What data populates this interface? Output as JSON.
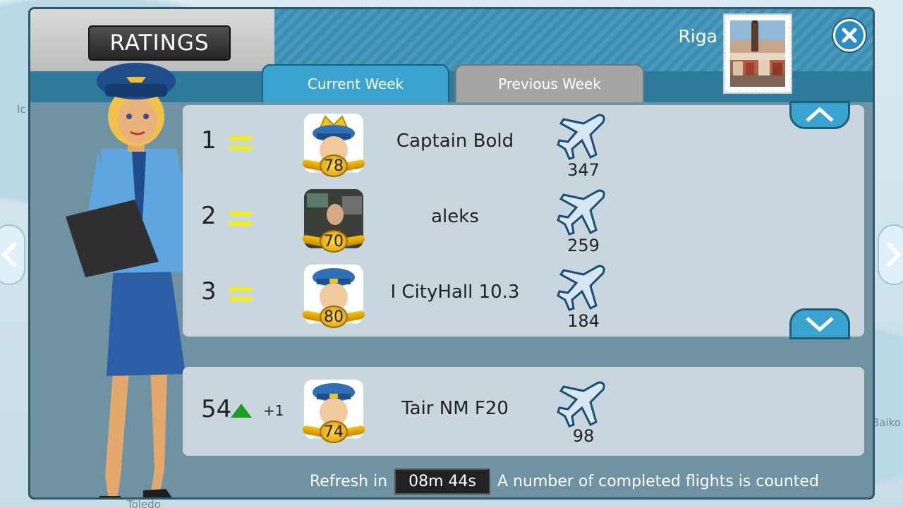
{
  "header": {
    "title": "RATINGS",
    "city": "Riga",
    "close_icon": "close-icon"
  },
  "tabs": [
    {
      "label": "Current Week",
      "active": true
    },
    {
      "label": "Previous Week",
      "active": false
    }
  ],
  "leaderboard": [
    {
      "rank": "1",
      "name": "Captain Bold",
      "level": "78",
      "flights": "347",
      "avatar": "pilot-crown"
    },
    {
      "rank": "2",
      "name": "aleks",
      "level": "70",
      "flights": "259",
      "avatar": "photo"
    },
    {
      "rank": "3",
      "name": "I CityHall 10.3",
      "level": "80",
      "flights": "184",
      "avatar": "pilot"
    }
  ],
  "player": {
    "rank": "54",
    "change": "+1",
    "name": "Tair NM F20",
    "level": "74",
    "flights": "98"
  },
  "footer": {
    "refresh_label": "Refresh in",
    "timer": "08m 44s",
    "note": "A number of completed flights is counted"
  },
  "map_labels": {
    "left_top": "Ic",
    "right": "Baiko",
    "bottom": "Toledo"
  },
  "colors": {
    "accent": "#3ba3d0",
    "equal_marker": "#f3ee17",
    "up_arrow": "#1e9c24"
  }
}
